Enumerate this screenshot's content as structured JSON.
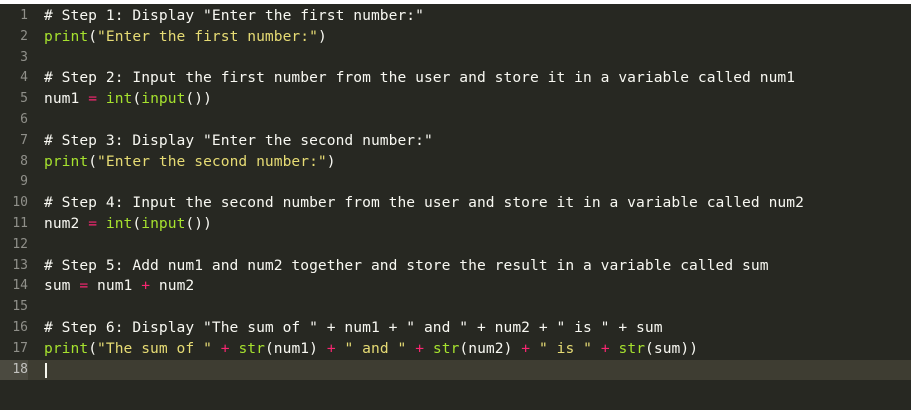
{
  "editor": {
    "lines": [
      {
        "n": "1",
        "tokens": [
          {
            "t": "cmt",
            "v": "# Step 1: Display \"Enter the first number:\""
          }
        ]
      },
      {
        "n": "2",
        "tokens": [
          {
            "t": "fn",
            "v": "print"
          },
          {
            "t": "pun",
            "v": "("
          },
          {
            "t": "str",
            "v": "\"Enter the first number:\""
          },
          {
            "t": "pun",
            "v": ")"
          }
        ]
      },
      {
        "n": "3",
        "tokens": []
      },
      {
        "n": "4",
        "tokens": [
          {
            "t": "cmt",
            "v": "# Step 2: Input the first number from the user and store it in a variable called num1"
          }
        ]
      },
      {
        "n": "5",
        "tokens": [
          {
            "t": "pun",
            "v": "num1 "
          },
          {
            "t": "op",
            "v": "="
          },
          {
            "t": "pun",
            "v": " "
          },
          {
            "t": "fn",
            "v": "int"
          },
          {
            "t": "pun",
            "v": "("
          },
          {
            "t": "fn",
            "v": "input"
          },
          {
            "t": "pun",
            "v": "())"
          }
        ]
      },
      {
        "n": "6",
        "tokens": []
      },
      {
        "n": "7",
        "tokens": [
          {
            "t": "cmt",
            "v": "# Step 3: Display \"Enter the second number:\""
          }
        ]
      },
      {
        "n": "8",
        "tokens": [
          {
            "t": "fn",
            "v": "print"
          },
          {
            "t": "pun",
            "v": "("
          },
          {
            "t": "str",
            "v": "\"Enter the second number:\""
          },
          {
            "t": "pun",
            "v": ")"
          }
        ]
      },
      {
        "n": "9",
        "tokens": []
      },
      {
        "n": "10",
        "tokens": [
          {
            "t": "cmt",
            "v": "# Step 4: Input the second number from the user and store it in a variable called num2"
          }
        ]
      },
      {
        "n": "11",
        "tokens": [
          {
            "t": "pun",
            "v": "num2 "
          },
          {
            "t": "op",
            "v": "="
          },
          {
            "t": "pun",
            "v": " "
          },
          {
            "t": "fn",
            "v": "int"
          },
          {
            "t": "pun",
            "v": "("
          },
          {
            "t": "fn",
            "v": "input"
          },
          {
            "t": "pun",
            "v": "())"
          }
        ]
      },
      {
        "n": "12",
        "tokens": []
      },
      {
        "n": "13",
        "tokens": [
          {
            "t": "cmt",
            "v": "# Step 5: Add num1 and num2 together and store the result in a variable called sum"
          }
        ]
      },
      {
        "n": "14",
        "tokens": [
          {
            "t": "pun",
            "v": "sum "
          },
          {
            "t": "op",
            "v": "="
          },
          {
            "t": "pun",
            "v": " num1 "
          },
          {
            "t": "op",
            "v": "+"
          },
          {
            "t": "pun",
            "v": " num2"
          }
        ]
      },
      {
        "n": "15",
        "tokens": []
      },
      {
        "n": "16",
        "tokens": [
          {
            "t": "cmt",
            "v": "# Step 6: Display \"The sum of \" + num1 + \" and \" + num2 + \" is \" + sum"
          }
        ]
      },
      {
        "n": "17",
        "tokens": [
          {
            "t": "fn",
            "v": "print"
          },
          {
            "t": "pun",
            "v": "("
          },
          {
            "t": "str",
            "v": "\"The sum of \""
          },
          {
            "t": "pun",
            "v": " "
          },
          {
            "t": "op",
            "v": "+"
          },
          {
            "t": "pun",
            "v": " "
          },
          {
            "t": "fn",
            "v": "str"
          },
          {
            "t": "pun",
            "v": "(num1) "
          },
          {
            "t": "op",
            "v": "+"
          },
          {
            "t": "pun",
            "v": " "
          },
          {
            "t": "str",
            "v": "\" and \""
          },
          {
            "t": "pun",
            "v": " "
          },
          {
            "t": "op",
            "v": "+"
          },
          {
            "t": "pun",
            "v": " "
          },
          {
            "t": "fn",
            "v": "str"
          },
          {
            "t": "pun",
            "v": "(num2) "
          },
          {
            "t": "op",
            "v": "+"
          },
          {
            "t": "pun",
            "v": " "
          },
          {
            "t": "str",
            "v": "\" is \""
          },
          {
            "t": "pun",
            "v": " "
          },
          {
            "t": "op",
            "v": "+"
          },
          {
            "t": "pun",
            "v": " "
          },
          {
            "t": "fn",
            "v": "str"
          },
          {
            "t": "pun",
            "v": "(sum))"
          }
        ]
      },
      {
        "n": "18",
        "tokens": [],
        "active": true
      }
    ]
  },
  "colors": {
    "background": "#272822",
    "comment": "#f8f8f2",
    "function": "#a6e22e",
    "string": "#e6db74",
    "operator": "#f92672",
    "gutter": "#90908a"
  }
}
